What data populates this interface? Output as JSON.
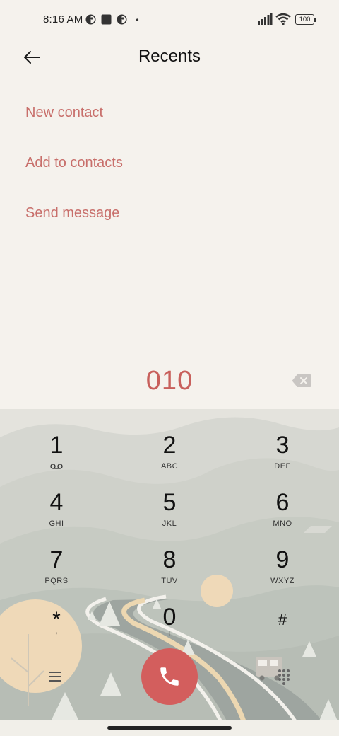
{
  "status_bar": {
    "time": "8:16 AM",
    "battery": "100"
  },
  "header": {
    "title": "Recents",
    "back_icon": "arrow-left-icon"
  },
  "actions": {
    "new_contact": "New contact",
    "add_to_contacts": "Add to contacts",
    "send_message": "Send message"
  },
  "dialer": {
    "number": "010",
    "backspace_icon": "backspace-icon",
    "keys": [
      {
        "digit": "1",
        "letters": ""
      },
      {
        "digit": "2",
        "letters": "ABC"
      },
      {
        "digit": "3",
        "letters": "DEF"
      },
      {
        "digit": "4",
        "letters": "GHI"
      },
      {
        "digit": "5",
        "letters": "JKL"
      },
      {
        "digit": "6",
        "letters": "MNO"
      },
      {
        "digit": "7",
        "letters": "PQRS"
      },
      {
        "digit": "8",
        "letters": "TUV"
      },
      {
        "digit": "9",
        "letters": "WXYZ"
      },
      {
        "digit": "*",
        "letters": ","
      },
      {
        "digit": "0",
        "letters": "+"
      },
      {
        "digit": "#",
        "letters": ""
      }
    ],
    "voicemail_icon": "voicemail-icon",
    "call_icon": "phone-icon",
    "menu_icon": "hamburger-menu-icon",
    "dialpad_icon": "dialpad-icon"
  },
  "colors": {
    "accent": "#c86f6b",
    "call_button": "#d35e5d",
    "background": "#f5f2ed"
  }
}
